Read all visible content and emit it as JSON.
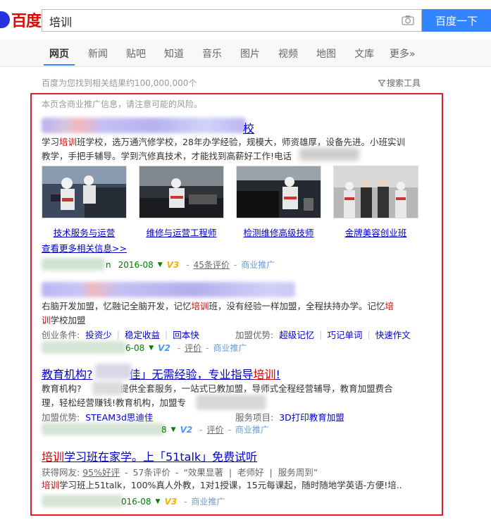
{
  "header": {
    "logo_text": "百度",
    "search_value": "培训",
    "search_button": "百度一下"
  },
  "nav": {
    "tabs": [
      "网页",
      "新闻",
      "贴吧",
      "知道",
      "音乐",
      "图片",
      "视频",
      "地图",
      "文库",
      "更多»"
    ]
  },
  "result_count": "百度为您找到相关结果约100,000,000个",
  "search_tools": "搜索工具",
  "notice": "本页含商业推广信息，请注意可能的风险。",
  "result1": {
    "title_tail": "校",
    "desc_line1": [
      "学习",
      "培训",
      "班学校，选万通汽修学校，28年办学经验，规模大，师资雄厚，设备先进。小班实训"
    ],
    "desc_line2": "教学，手把手辅导。学到汽修真技术，才能找到高薪好工作!电话",
    "images": [
      {
        "caption": "技术服务与运营"
      },
      {
        "caption": "维修与运营工程师"
      },
      {
        "caption": "检测维修高级技师"
      },
      {
        "caption": "金牌美容创业班"
      }
    ],
    "more_link": "查看更多相关信息>>",
    "date": "2016-08",
    "level": "V3",
    "reviews": "45条评价",
    "promo": "商业推广",
    "url_tail": "n"
  },
  "result2": {
    "desc_line1": [
      "右脑开发加盟，忆融记全脑开发，记忆",
      "培训",
      "班，没有经验一样加盟，全程扶持办学。记忆",
      "培"
    ],
    "desc_line2": [
      "训",
      "学校加盟"
    ],
    "cond_label": "创业条件:",
    "conds": [
      "投资少",
      "稳定收益",
      "回本快"
    ],
    "adv_label": "加盟优势:",
    "advs": [
      "超级记忆",
      "巧记单词",
      "快速作文"
    ],
    "date_tail": "6-08",
    "level": "V2",
    "reviews": "评价",
    "promo": "商业推广"
  },
  "result3": {
    "title_parts": [
      "教育机构?",
      "佳」无需经验，专业指导",
      "培训",
      "!"
    ],
    "desc_line1": [
      "教育机构?",
      "」提供全套服务，一站式已教加盟，",
      "导师式全程经营辅导，教育加盟费合"
    ],
    "desc_line2": "理，轻松经营赚钱!教育机构，加盟专",
    "adv_label": "加盟优势:",
    "adv_value": "STEAM3d思迪佳",
    "proj_label": "服务项目:",
    "proj_value": "3D打印教育加盟",
    "date_tail": "8",
    "level": "V2",
    "reviews": "评价",
    "promo": "商业推广"
  },
  "result4": {
    "title_parts": [
      "培训",
      "学习班在家学。上「51talk」免费试听"
    ],
    "stats": [
      "获得网友:",
      "95%好评",
      "-",
      "57条评价",
      "-",
      "“效果显著",
      "|",
      "老师好",
      "|",
      "服务周到”"
    ],
    "desc": [
      "培训",
      "学习班上51talk，100%真人外教，1对1授课，15元每课起，随时随地学英语-方便!培.."
    ],
    "date_tail": "016-08",
    "level": "V3",
    "promo": "商业推广"
  },
  "colors": {
    "accent": "#3385ff",
    "highlight": "#cc0000",
    "link": "#0000cc",
    "frame": "#e41e26",
    "date_green": "#008000"
  }
}
